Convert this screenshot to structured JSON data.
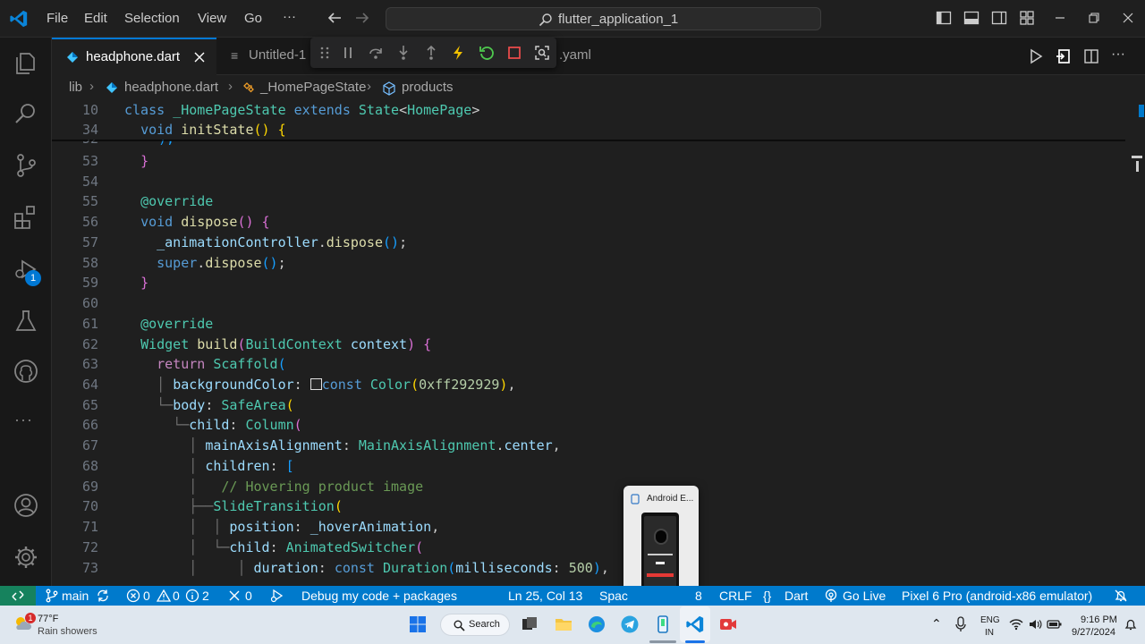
{
  "titlebar": {
    "menus": [
      "File",
      "Edit",
      "Selection",
      "View",
      "Go"
    ],
    "more": "···",
    "search_text": "flutter_application_1",
    "window_controls": [
      "minimize-icon",
      "restore-icon",
      "close-icon"
    ]
  },
  "tabs": [
    {
      "label": "headphone.dart",
      "active": true
    },
    {
      "label": "Untitled-1",
      "active": false
    },
    {
      "label": ".yaml",
      "active": false
    }
  ],
  "breadcrumb": [
    "lib",
    "headphone.dart",
    "_HomePageState",
    "products"
  ],
  "sticky": [
    {
      "n": "10",
      "html": "<span class=\"kw\">class</span> <span class=\"ty\">_HomePageState</span> <span class=\"kw\">extends</span> <span class=\"ty\">State</span>&lt;<span class=\"ty\">HomePage</span>&gt;"
    },
    {
      "n": "34",
      "html": "  <span class=\"kw\">void</span> <span class=\"fn\">initState</span><span class=\"p1\">()</span> <span class=\"p1\">{</span>"
    }
  ],
  "lines": [
    {
      "n": "53",
      "html": "  <span class=\"p2\">}</span>"
    },
    {
      "n": "54",
      "html": ""
    },
    {
      "n": "55",
      "html": "  <span class=\"ann\">@override</span>"
    },
    {
      "n": "56",
      "html": "  <span class=\"kw\">void</span> <span class=\"fn\">dispose</span><span class=\"p2\">()</span> <span class=\"p2\">{</span>"
    },
    {
      "n": "57",
      "html": "    <span class=\"vr\">_animationController</span>.<span class=\"fn\">dispose</span><span class=\"p3\">()</span>;"
    },
    {
      "n": "58",
      "html": "    <span class=\"kw\">super</span>.<span class=\"fn\">dispose</span><span class=\"p3\">()</span>;"
    },
    {
      "n": "59",
      "html": "  <span class=\"p2\">}</span>"
    },
    {
      "n": "60",
      "html": ""
    },
    {
      "n": "61",
      "html": "  <span class=\"ann\">@override</span>"
    },
    {
      "n": "62",
      "html": "  <span class=\"ty\">Widget</span> <span class=\"fn\">build</span><span class=\"p2\">(</span><span class=\"ty\">BuildContext</span> <span class=\"vr\">context</span><span class=\"p2\">)</span> <span class=\"p2\">{</span>"
    },
    {
      "n": "63",
      "html": "    <span class=\"kw2\">return</span> <span class=\"ty\">Scaffold</span><span class=\"p3\">(</span>"
    },
    {
      "n": "64",
      "html": "    <span class=\"guide\">│</span> <span class=\"vr\">backgroundColor</span>: <span style=\"display:inline-block;width:13px;height:13px;border:1px solid #e0e0e0;background:#292929;vertical-align:-1px\"></span><span class=\"kw\">const</span> <span class=\"ty\">Color</span><span class=\"p1\">(</span><span class=\"nm\">0xff292929</span><span class=\"p1\">)</span>,"
    },
    {
      "n": "65",
      "html": "    <span class=\"guide\">└─</span><span class=\"vr\">body</span>: <span class=\"ty\">SafeArea</span><span class=\"p1\">(</span>"
    },
    {
      "n": "66",
      "html": "      <span class=\"guide\">└─</span><span class=\"vr\">child</span>: <span class=\"ty\">Column</span><span class=\"p2\">(</span>"
    },
    {
      "n": "67",
      "html": "        <span class=\"guide\">│</span> <span class=\"vr\">mainAxisAlignment</span>: <span class=\"ty\">MainAxisAlignment</span>.<span class=\"vr\">center</span>,"
    },
    {
      "n": "68",
      "html": "        <span class=\"guide\">│</span> <span class=\"vr\">children</span>: <span class=\"p3\">[</span>"
    },
    {
      "n": "69",
      "html": "        <span class=\"guide\">│</span>   <span class=\"cm\">// Hovering product image</span>"
    },
    {
      "n": "70",
      "html": "        <span class=\"guide\">├──</span><span class=\"ty\">SlideTransition</span><span class=\"p1\">(</span>"
    },
    {
      "n": "71",
      "html": "        <span class=\"guide\">│</span>  <span class=\"guide\">│</span> <span class=\"vr\">position</span>: <span class=\"vr\">_hoverAnimation</span>,"
    },
    {
      "n": "72",
      "html": "        <span class=\"guide\">│</span>  <span class=\"guide\">└─</span><span class=\"vr\">child</span>: <span class=\"ty\">AnimatedSwitcher</span><span class=\"p2\">(</span>"
    },
    {
      "n": "73",
      "html": "        <span class=\"guide\">│</span>     <span class=\"guide\">│</span> <span class=\"vr\">duration</span>: <span class=\"kw\">const</span> <span class=\"ty\">Duration</span><span class=\"p3\">(</span><span class=\"vr\">milliseconds</span>: <span class=\"nm\">500</span><span class=\"p3\">)</span>,"
    }
  ],
  "popup": {
    "title": "Android E..."
  },
  "statusbar": {
    "branch": "main",
    "errors": "0",
    "warnings": "0",
    "infos": "2",
    "ports": "0",
    "debug": "Debug my code + packages",
    "position": "Ln 25, Col 13",
    "spaces": "Spac",
    "encoding": "8",
    "eol": "CRLF",
    "language": "Dart",
    "golive": "Go Live",
    "device": "Pixel 6 Pro (android-x86 emulator)"
  },
  "activity_badge": "1",
  "taskbar": {
    "weather_badge": "1",
    "temp": "77°F",
    "weather": "Rain showers",
    "search": "Search",
    "lang1": "ENG",
    "lang2": "IN",
    "time": "9:16 PM",
    "date": "9/27/2024"
  }
}
